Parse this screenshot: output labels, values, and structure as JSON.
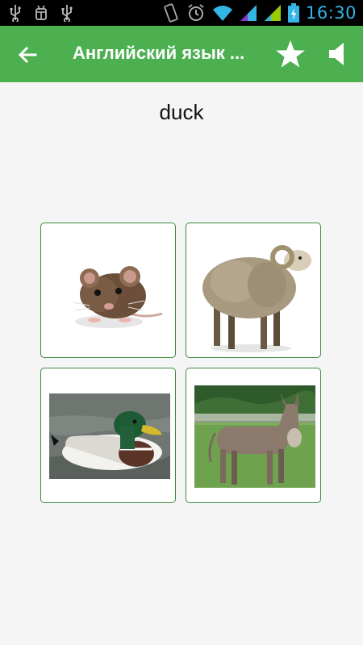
{
  "status_bar": {
    "time": "16:30",
    "icons": [
      "usb-icon",
      "android-debug-icon",
      "usb-icon",
      "vibrate-icon",
      "alarm-icon",
      "wifi-icon",
      "signal-icon",
      "signal-icon",
      "battery-charging-icon"
    ]
  },
  "app_bar": {
    "title": "Английский язык ...",
    "back_icon": "arrow-left-icon",
    "favorite_icon": "star-icon",
    "sound_icon": "speaker-icon",
    "color": "#4caf50"
  },
  "quiz": {
    "word": "duck",
    "options": [
      {
        "image": "mouse-photo"
      },
      {
        "image": "sheep-photo"
      },
      {
        "image": "duck-photo"
      },
      {
        "image": "donkey-photo"
      }
    ],
    "card_border_color": "#3a8a3e"
  }
}
